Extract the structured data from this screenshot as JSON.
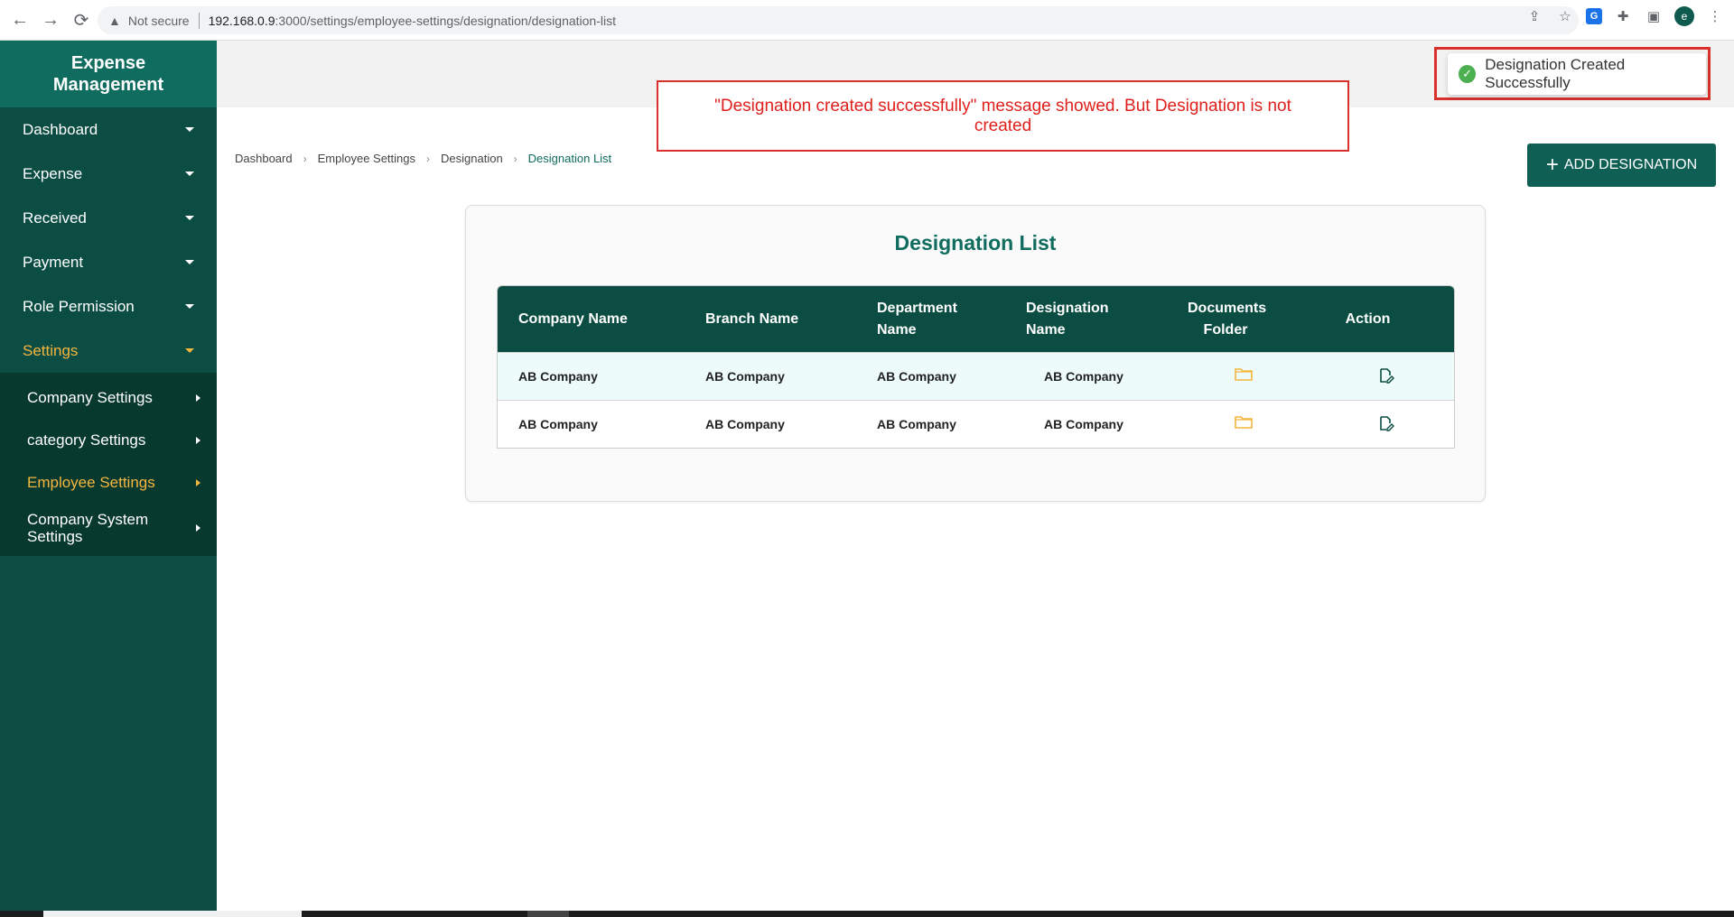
{
  "browser": {
    "security_label": "Not secure",
    "url_host": "192.168.0.9",
    "url_path": ":3000/settings/employee-settings/designation/designation-list",
    "profile_initial": "e",
    "translate_icon_label": "G"
  },
  "sidebar": {
    "brand": "Expense Management",
    "items": [
      {
        "label": "Dashboard"
      },
      {
        "label": "Expense"
      },
      {
        "label": "Received"
      },
      {
        "label": "Payment"
      },
      {
        "label": "Role Permission"
      },
      {
        "label": "Settings"
      }
    ],
    "settings_sub": [
      {
        "label": "Company Settings"
      },
      {
        "label": "category Settings"
      },
      {
        "label": "Employee Settings"
      },
      {
        "label": "Company System Settings"
      }
    ],
    "active_color": "#f4b63f"
  },
  "breadcrumb": [
    "Dashboard",
    "Employee Settings",
    "Designation",
    "Designation List"
  ],
  "add_button_label": "ADD DESIGNATION",
  "annotation_text": "\"Designation created successfully\" message showed. But Designation is not created",
  "toast_text": "Designation Created Successfully",
  "card_title": "Designation List",
  "table": {
    "headers": [
      "Company Name",
      "Branch Name",
      "Department Name",
      "Designation Name",
      "Documents Folder",
      "Action"
    ],
    "rows": [
      [
        "AB Company",
        "AB Company",
        "AB Company",
        "AB Company"
      ],
      [
        "AB Company",
        "AB Company",
        "AB Company",
        "AB Company"
      ]
    ]
  },
  "colors": {
    "primary": "#0f6c5e",
    "sidebar": "#0b4d43",
    "folder": "#f4b63f",
    "annotation": "#e0201c"
  }
}
